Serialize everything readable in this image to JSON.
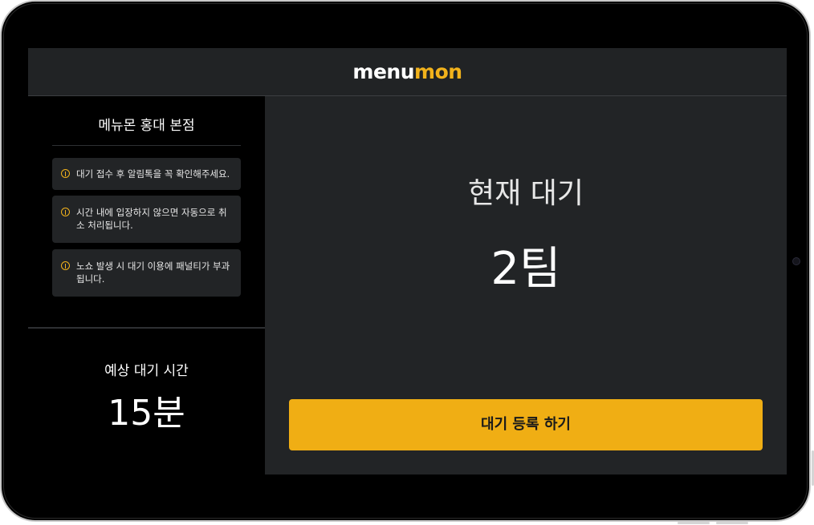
{
  "header": {
    "logo_part_1": "menu",
    "logo_part_2": "mon"
  },
  "store": {
    "name": "메뉴몬 홍대 본점"
  },
  "notices": [
    {
      "icon": "info-circle-icon",
      "text": "대기 접수 후 알림톡을 꼭 확인해주세요."
    },
    {
      "icon": "info-circle-icon",
      "text": "시간 내에 입장하지 않으면 자동으로 취소 처리됩니다."
    },
    {
      "icon": "info-circle-icon",
      "text": "노쇼 발생 시 대기 이용에 패널티가 부과됩니다."
    }
  ],
  "estimate": {
    "label": "예상 대기 시간",
    "value": "15분"
  },
  "current": {
    "label": "현재 대기",
    "count": "2팀"
  },
  "register_button": {
    "label": "대기 등록 하기"
  },
  "colors": {
    "accent": "#f0ae14",
    "panel_dark": "#222426",
    "header": "#212325",
    "background": "#000000"
  }
}
